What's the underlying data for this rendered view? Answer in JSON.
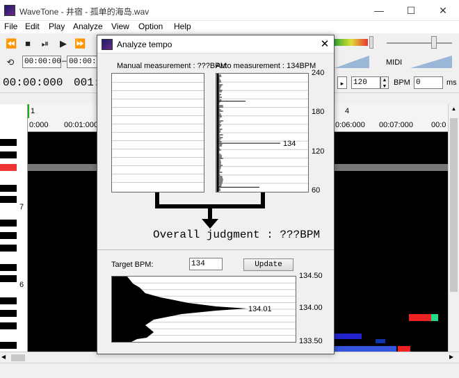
{
  "window": {
    "title": "WaveTone - 井宿 - 孤单的海岛.wav",
    "minimize": "—",
    "maximize": "☐",
    "close": "✕"
  },
  "menu": [
    "File",
    "Edit",
    "Play",
    "Analyze",
    "View",
    "Option",
    "Help"
  ],
  "toolbar": {
    "start_time": "00:00:00(",
    "end_time": "00:00:00",
    "current_time": "00:00:000",
    "bar_beat": "001:0",
    "bpm_value": "120",
    "bpm_label": "BPM",
    "offset_value": "0",
    "offset_unit": "ms",
    "midi_label": "MIDI",
    "icons": [
      "rewind-icon",
      "stop-icon",
      "play-pause-icon",
      "play-icon",
      "fast-forward-icon",
      "loop-icon"
    ]
  },
  "ruler": {
    "measures": [
      {
        "label": "1"
      },
      {
        "label": "4"
      }
    ],
    "times": [
      "0:000",
      "00:01:000",
      "0:06:000",
      "00:07:000",
      "00:0"
    ]
  },
  "keyboard": {
    "octave_labels": [
      "7",
      "6"
    ]
  },
  "dialog": {
    "title": "Analyze tempo",
    "manual_label": "Manual measurement : ???BPM",
    "auto_label": "Auto measurement : 134BPM",
    "auto_y_ticks": [
      "240",
      "180",
      "120",
      "60"
    ],
    "peak_label": "134",
    "overall": "Overall judgment : ???BPM",
    "target_label": "Target BPM:",
    "target_value": "134",
    "update_label": "Update",
    "fine_y_ticks": [
      "134.50",
      "134.00",
      "133.50"
    ],
    "fine_peak_label": "134.01"
  },
  "chart_data": {
    "type": "bar",
    "title": "Auto measurement : 134BPM",
    "ylim": [
      60,
      240
    ],
    "peak": 134,
    "fine": {
      "ylim": [
        133.5,
        134.5
      ],
      "peak": 134.01
    }
  }
}
